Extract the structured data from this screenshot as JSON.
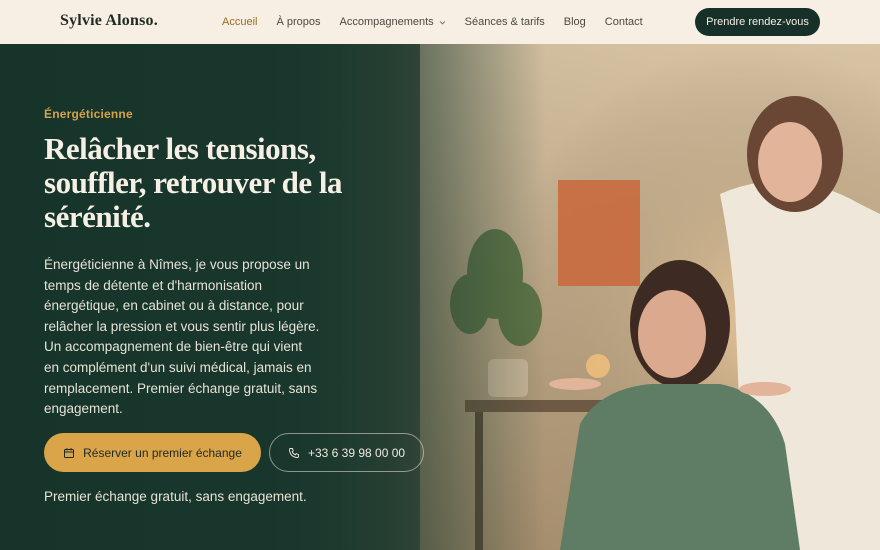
{
  "header": {
    "logo": "Sylvie Alonso.",
    "nav": [
      {
        "label": "Accueil",
        "active": true
      },
      {
        "label": "À propos"
      },
      {
        "label": "Accompagnements",
        "dropdown": true
      },
      {
        "label": "Séances & tarifs"
      },
      {
        "label": "Blog"
      },
      {
        "label": "Contact"
      }
    ],
    "cta": "Prendre rendez-vous"
  },
  "hero": {
    "eyebrow": "Énergéticienne",
    "headline_lines": [
      "Relâcher les tensions,",
      "souffler, retrouver de la",
      "sérénité."
    ],
    "body": "Énergéticienne à Nîmes, je vous propose un temps de détente et d'harmonisation énergétique, en cabinet ou à distance, pour relâcher la pression et vous sentir plus légère. Un accompagnement de bien-être qui vient en complément d'un suivi médical, jamais en remplacement. Premier échange gratuit, sans engagement.",
    "primary_button": {
      "label": "Réserver un premier échange",
      "icon": "calendar-icon"
    },
    "phone_button": {
      "label": "+33 6 39 98 00 00",
      "icon": "phone-icon"
    },
    "footnote": "Premier échange gratuit, sans engagement."
  },
  "colors": {
    "header_bg": "#f7efe3",
    "dark_green": "#17302a",
    "accent_gold": "#d9a548",
    "eyebrow_gold": "#d3a24a"
  }
}
